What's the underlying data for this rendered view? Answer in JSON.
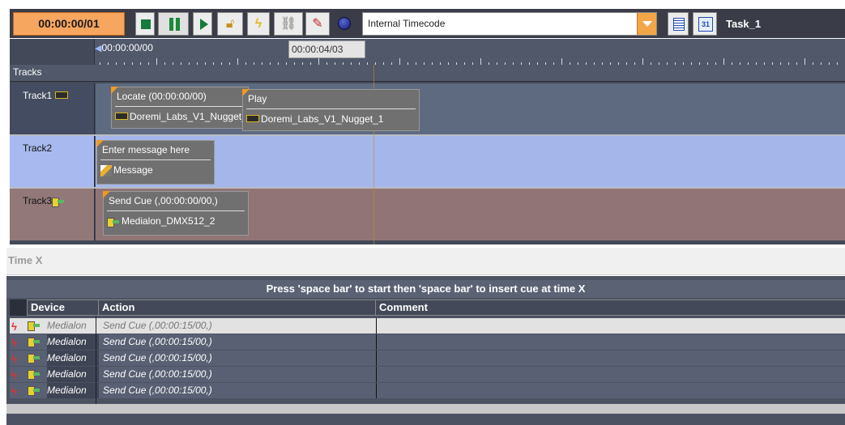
{
  "toolbar": {
    "timecode": "00:00:00/01",
    "lock_icon": "lock-icon",
    "flash_icon": "lightning-icon",
    "link_icon": "chain-link-icon",
    "wrench_icon": "wrench-icon",
    "source_value": "Internal Timecode",
    "task_name": "Task_1"
  },
  "ruler": {
    "start": "00:00:00/00",
    "marker": "00:00:04/03"
  },
  "tracks": {
    "header": "Tracks",
    "items": [
      {
        "name": "Track1"
      },
      {
        "name": "Track2"
      },
      {
        "name": "Track3"
      }
    ]
  },
  "cues": {
    "locate": {
      "title": "Locate (00:00:00/00)",
      "device": "Doremi_Labs_V1_Nugget_1"
    },
    "play": {
      "title": "Play",
      "device": "Doremi_Labs_V1_Nugget_1"
    },
    "message": {
      "title": "Enter message here",
      "device": "Message"
    },
    "sendcue": {
      "title": "Send Cue (,00:00:00/00,)",
      "device": "Medialon_DMX512_2"
    }
  },
  "timex": {
    "title": "Time X",
    "instructions": "Press 'space bar' to start then 'space bar' to insert cue at time X",
    "columns": {
      "device": "Device",
      "action": "Action",
      "comment": "Comment"
    },
    "rows": [
      {
        "device": "Medialon",
        "action": "Send Cue (,00:00:15/00,)",
        "comment": ""
      },
      {
        "device": "Medialon",
        "action": "Send Cue (,00:00:15/00,)",
        "comment": ""
      },
      {
        "device": "Medialon",
        "action": "Send Cue (,00:00:15/00,)",
        "comment": ""
      },
      {
        "device": "Medialon",
        "action": "Send Cue (,00:00:15/00,)",
        "comment": ""
      },
      {
        "device": "Medialon",
        "action": "Send Cue (,00:00:15/00,)",
        "comment": ""
      }
    ]
  },
  "colors": {
    "timecode_bg": "#f6a65f",
    "track1_bg": "#5e6a80",
    "track2_bg": "#a4b6ea",
    "track3_bg": "#917576",
    "cue_corner": "#f09a25"
  }
}
